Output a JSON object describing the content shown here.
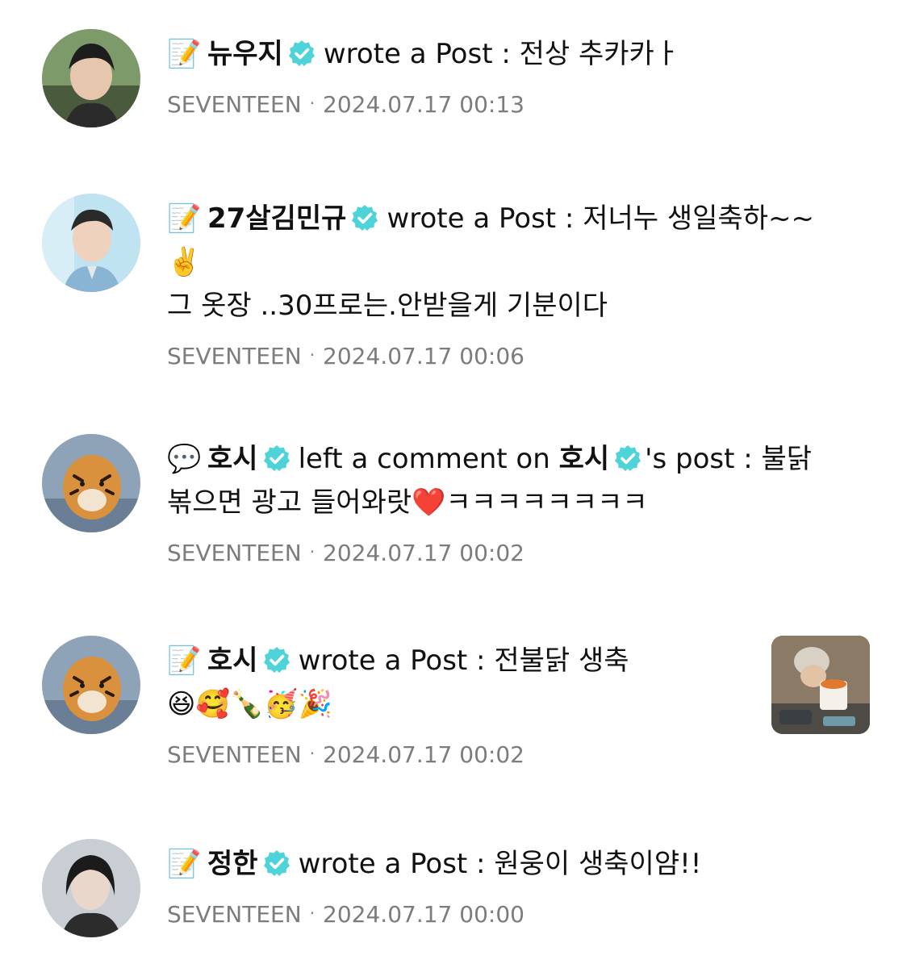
{
  "feed": {
    "items": [
      {
        "icon": "memo-icon",
        "emoji": "📝",
        "name": "뉴우지",
        "action": "wrote a Post :",
        "text_line1": "전상 추카카ㅏ",
        "group": "SEVENTEEN",
        "separator": "·",
        "timestamp": "2024.07.17 00:13"
      },
      {
        "icon": "memo-icon",
        "emoji": "📝",
        "name": "27살김민규",
        "action": "wrote a Post :",
        "text_line1": "저너누 생일축하~~",
        "text_line2": "✌️",
        "text_line3": "그 옷장 ..30프로는.안받을게 기분이다",
        "group": "SEVENTEEN",
        "separator": "·",
        "timestamp": "2024.07.17 00:06"
      },
      {
        "icon": "speech-bubble-icon",
        "emoji": "💬",
        "name": "호시",
        "action": "left a comment on",
        "target_name": "호시",
        "text_line1": "'s post : 불닭",
        "text_line2": "볶으면 광고 들어와랏❤️ㅋㅋㅋㅋㅋㅋㅋㅋ",
        "group": "SEVENTEEN",
        "separator": "·",
        "timestamp": "2024.07.17 00:02"
      },
      {
        "icon": "memo-icon",
        "emoji": "📝",
        "name": "호시",
        "action": "wrote a Post :",
        "text_line1": "전불닭 생축",
        "text_line2": "😆🥰🍾🥳🎉",
        "group": "SEVENTEEN",
        "separator": "·",
        "timestamp": "2024.07.17 00:02"
      },
      {
        "icon": "memo-icon",
        "emoji": "📝",
        "name": "정한",
        "action": "wrote a Post :",
        "text_line1": "원웅이 생축이얌!!",
        "group": "SEVENTEEN",
        "separator": "·",
        "timestamp": "2024.07.17 00:00"
      }
    ]
  },
  "colors": {
    "verified_badge": "#4dd3d8",
    "meta_text": "#7c7c7c",
    "primary_text": "#111111"
  }
}
